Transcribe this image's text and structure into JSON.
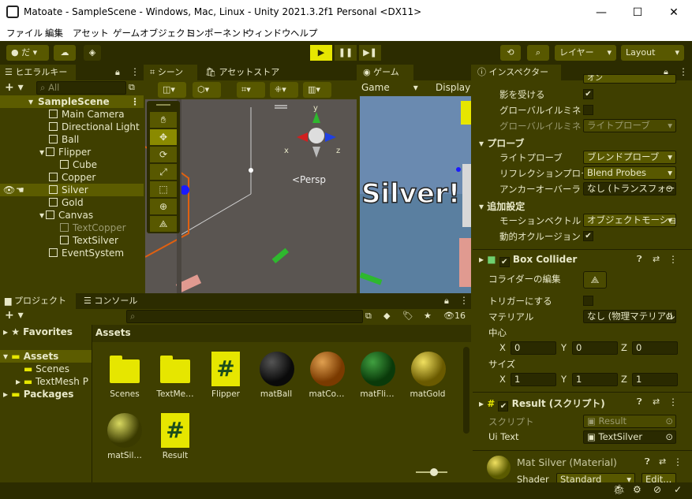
{
  "window": {
    "title": "Matoate - SampleScene - Windows, Mac, Linux - Unity 2021.3.2f1 Personal <DX11>",
    "minimize": "—",
    "maximize": "☐",
    "close": "✕"
  },
  "menu": [
    "ファイル",
    "編集",
    "アセット",
    "ゲームオブジェクト",
    "コンポーネント",
    "ウィンドウ",
    "ヘルプ"
  ],
  "toolbar": {
    "account": "だ",
    "layers": "レイヤー",
    "layout": "Layout"
  },
  "hierarchy": {
    "tab": "ヒエラルキー",
    "search_placeholder": "All",
    "items": [
      "SampleScene",
      "Main Camera",
      "Directional Light",
      "Ball",
      "Flipper",
      "Cube",
      "Copper",
      "Silver",
      "Gold",
      "Canvas",
      "TextCopper",
      "TextSilver",
      "EventSystem"
    ]
  },
  "scene": {
    "tab_scene": "シーン",
    "tab_store": "アセットストア",
    "persp": "<Persp",
    "axis_y": "y",
    "axis_x": "x",
    "axis_z": "z"
  },
  "game": {
    "tab": "ゲーム",
    "display": "Game",
    "display2": "Display",
    "text": "Silver!"
  },
  "project": {
    "tab_project": "プロジェクト",
    "tab_console": "コンソール",
    "count": "16",
    "favorites": "Favorites",
    "assets": "Assets",
    "tree": [
      "Scenes",
      "TextMesh P"
    ],
    "packages": "Packages",
    "header": "Assets",
    "items": [
      "Scenes",
      "TextMe…",
      "Flipper",
      "matBall",
      "matCo…",
      "matFli…",
      "matGold",
      "matSil…",
      "Result"
    ]
  },
  "inspector": {
    "tab": "インスペクター",
    "top_cut": "オン",
    "shadow_receive": "影を受ける",
    "gi": "グローバルイルミネーション",
    "gi2": "グローバルイルミネーション",
    "gi2_val": "ライトプローブ",
    "probe": "プローブ",
    "light_probe": "ライトプローブ",
    "light_probe_val": "ブレンドプローブ",
    "reflection_probe": "リフレクションプローブ",
    "reflection_probe_val": "Blend Probes",
    "anchor": "アンカーオーバーライド",
    "anchor_val": "なし (トランスフォーム",
    "extra": "追加設定",
    "motion": "モーションベクトル",
    "motion_val": "オブジェクトモーション",
    "dyn_occ": "動的オクルージョン",
    "box_collider": "Box Collider",
    "edit_collider": "コライダーの編集",
    "is_trigger": "トリガーにする",
    "material": "マテリアル",
    "material_val": "なし (物理マテリアル",
    "center": "中心",
    "cx": "0",
    "cy": "0",
    "cz": "0",
    "size": "サイズ",
    "sx": "1",
    "sy": "1",
    "sz": "1",
    "result": "Result (スクリプト)",
    "script": "スクリプト",
    "script_val": "Result",
    "ui_text": "Ui Text",
    "ui_text_val": "TextSilver",
    "mat": "Mat Silver (Material)",
    "shader": "Shader",
    "shader_val": "Standard",
    "edit": "Edit..."
  },
  "labels": {
    "x": "X",
    "y": "Y",
    "z": "Z"
  }
}
